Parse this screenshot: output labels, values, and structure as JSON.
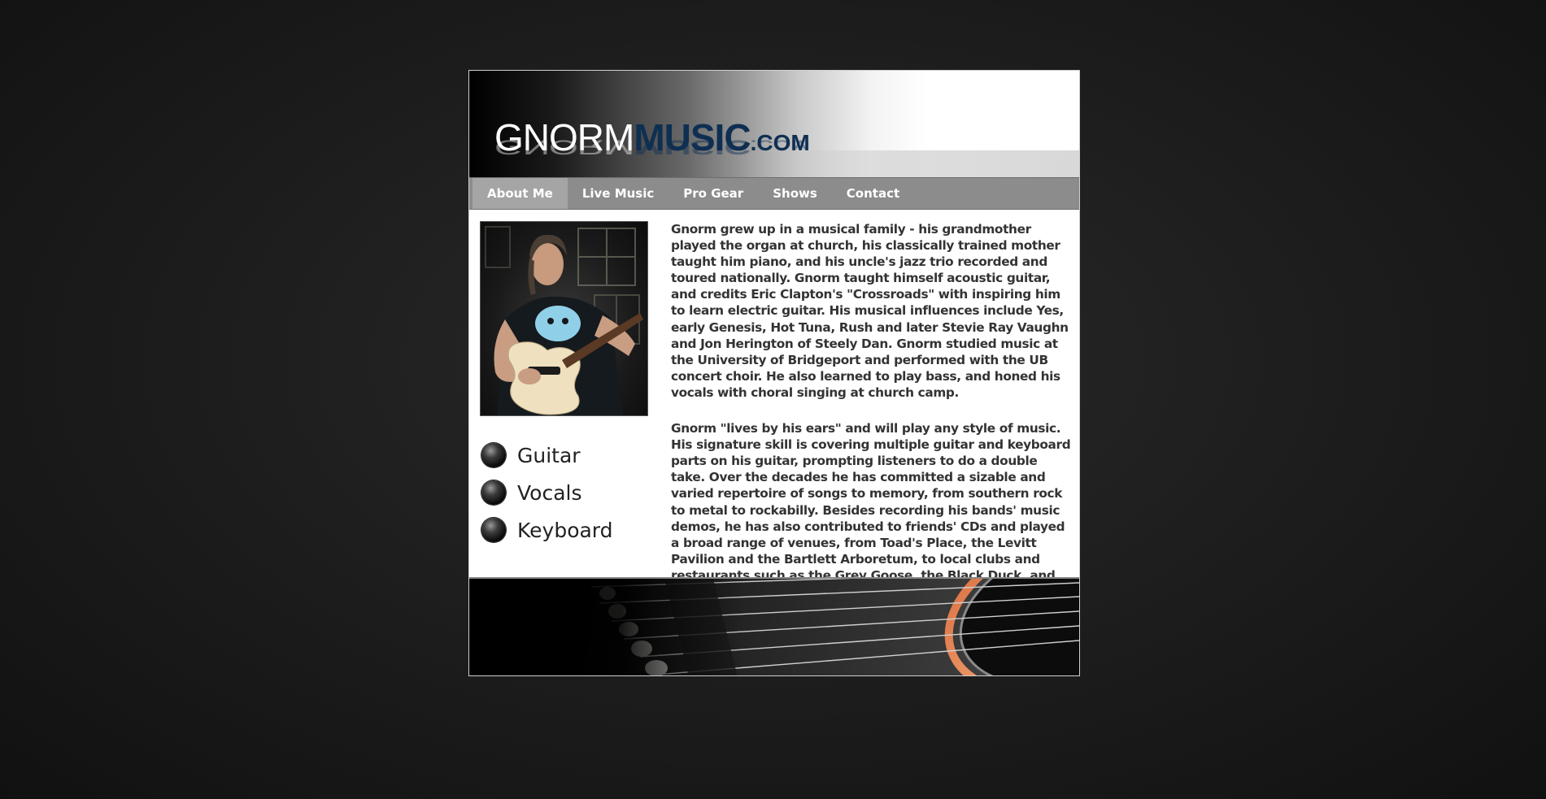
{
  "logo": {
    "part1": "GNORM",
    "part2": "MUSIC",
    "part3": ".COM"
  },
  "nav": {
    "items": [
      {
        "label": "About Me",
        "active": true
      },
      {
        "label": "Live Music",
        "active": false
      },
      {
        "label": "Pro Gear",
        "active": false
      },
      {
        "label": "Shows",
        "active": false
      },
      {
        "label": "Contact",
        "active": false
      }
    ]
  },
  "skills": [
    {
      "label": "Guitar",
      "icon": "dark-orb-icon"
    },
    {
      "label": "Vocals",
      "icon": "dark-orb-icon"
    },
    {
      "label": "Keyboard",
      "icon": "dark-orb-icon"
    }
  ],
  "bio": {
    "paragraph1": "Gnorm grew up in a musical family - his grandmother played the organ at church, his classically trained mother taught him piano, and his uncle's jazz trio recorded and toured nationally. Gnorm taught himself acoustic guitar, and credits Eric Clapton's \"Crossroads\" with inspiring him to learn electric guitar. His musical influences include Yes, early Genesis, Hot Tuna, Rush and later Stevie Ray Vaughn and Jon Herington of Steely Dan. Gnorm studied music at the University of Bridgeport and performed with the UB concert choir. He also learned to play bass, and honed his vocals with choral singing at church camp.",
    "paragraph2": "Gnorm \"lives by his ears\" and will play any style of music. His signature skill is covering multiple guitar and keyboard parts on his guitar, prompting listeners to do a double take. Over the decades he has committed a sizable and varied repertoire of songs to memory, from southern rock to metal to rockabilly. Besides recording his bands' music demos, he has also contributed to friends' CDs and played a broad range of venues, from Toad's Place, the Levitt Pavilion and the Bartlett Arboretum, to local clubs and restaurants such as the Grey Goose, the Black Duck, and the Spotted Horse."
  },
  "colors": {
    "logo_accent": "#0f2f52",
    "nav_background": "#8c8c8c",
    "nav_active": "#a5a5a5",
    "text": "#333333"
  }
}
